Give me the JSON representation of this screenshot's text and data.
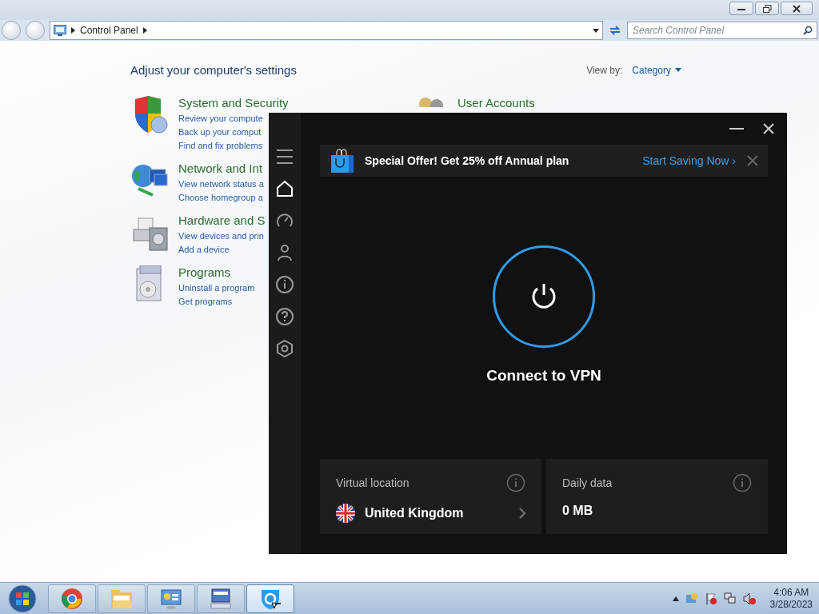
{
  "control_panel": {
    "address": {
      "crumbs": [
        "Control Panel"
      ]
    },
    "search": {
      "placeholder": "Search Control Panel"
    },
    "heading": "Adjust your computer's settings",
    "view_by": {
      "label": "View by:",
      "value": "Category"
    },
    "categories": [
      {
        "kind": "security",
        "title": "System and Security",
        "links": [
          "Review your compute",
          "Back up your comput",
          "Find and fix problems"
        ]
      },
      {
        "kind": "network",
        "title": "Network and Int",
        "links": [
          "View network status a",
          "Choose homegroup a"
        ]
      },
      {
        "kind": "hardware",
        "title": "Hardware and S",
        "links": [
          "View devices and prin",
          "Add a device"
        ]
      },
      {
        "kind": "programs",
        "title": "Programs",
        "links": [
          "Uninstall a program",
          "Get programs"
        ]
      }
    ],
    "right_categories": [
      {
        "kind": "users",
        "title": "User Accounts"
      }
    ]
  },
  "vpn": {
    "promo": {
      "text": "Special Offer! Get 25% off Annual plan",
      "link": "Start Saving Now ›"
    },
    "nav": [
      {
        "kind": "menu",
        "selected": false
      },
      {
        "kind": "home",
        "selected": true
      },
      {
        "kind": "speed",
        "selected": false
      },
      {
        "kind": "account",
        "selected": false
      },
      {
        "kind": "info",
        "selected": false
      },
      {
        "kind": "help",
        "selected": false
      },
      {
        "kind": "settings",
        "selected": false
      }
    ],
    "connect": {
      "label": "Connect to VPN"
    },
    "cards": [
      {
        "kind": "location",
        "label": "Virtual location",
        "value": "United Kingdom"
      },
      {
        "kind": "data",
        "label": "Daily data",
        "value": "0 MB"
      }
    ]
  },
  "taskbar": {
    "apps": [
      {
        "kind": "chrome",
        "active": false
      },
      {
        "kind": "explorer",
        "active": false
      },
      {
        "kind": "control",
        "active": false
      },
      {
        "kind": "computer",
        "active": false
      },
      {
        "kind": "vpn",
        "active": true
      }
    ],
    "clock": {
      "time": "4:06 AM",
      "date": "3/28/2023"
    }
  }
}
